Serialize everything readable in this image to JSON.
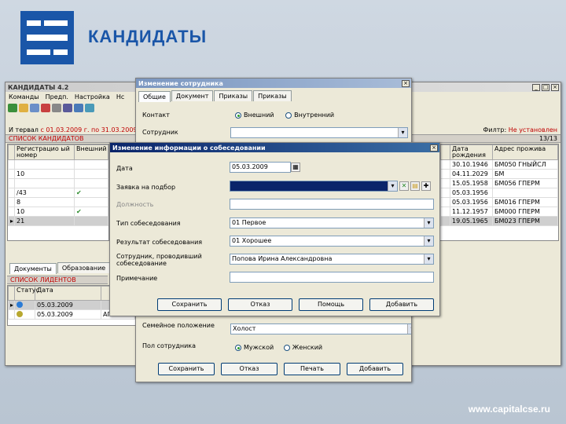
{
  "slide": {
    "title": "КАНДИДАТЫ",
    "footer": "www.capitalcse.ru"
  },
  "app": {
    "title": "КАНДИДАТЫ 4.2",
    "menu": [
      "Команды",
      "Предп.",
      "Настройка",
      "Нс"
    ],
    "filter_prefix": "И тервал",
    "filter_value": "с 01.03.2009 г. по 31.03.2009 г.",
    "filter_label": "Филтр:",
    "filter_state": "Не установлен",
    "list_header": "СПИСОК КАНДИДАТОВ",
    "list_count": "13/13",
    "columns": [
      "Регистрацио ый номер",
      "Внешний"
    ],
    "rows": [
      {
        "num": "",
        "check": ""
      },
      {
        "num": "10",
        "check": ""
      },
      {
        "num": "",
        "check": ""
      },
      {
        "num": "/43",
        "check": "✔"
      },
      {
        "num": "8",
        "check": ""
      },
      {
        "num": "10",
        "check": "✔"
      },
      {
        "num": "21",
        "check": ""
      }
    ],
    "right_columns": [
      "Дата рождения",
      "Адрес прожива"
    ],
    "right_rows": [
      [
        "30.10.1946",
        "БМ050 ГНЫЙСЛ"
      ],
      [
        "04.11.2029",
        "БМ"
      ],
      [
        "15.05.1958",
        "БМ056 ГПЕРМ"
      ],
      [
        "05.03.1956",
        ""
      ],
      [
        "05.03.1956",
        "БМ016 ГПЕРМ"
      ],
      [
        "11.12.1957",
        "БМ000 ГПЕРМ"
      ],
      [
        "19.05.1965",
        "БМ023 ГПЕРМ"
      ]
    ],
    "bottom_tabs": [
      "Документы",
      "Образование"
    ],
    "interviews_header": "СПИСОК ЛИДЕНТОВ",
    "interviews_columns": [
      "Статус",
      "Дата"
    ],
    "interviews_rows": [
      {
        "date": "05.03.2009",
        "extra": ""
      },
      {
        "date": "05.03.2009",
        "extra": "АГЕН"
      }
    ]
  },
  "employee": {
    "title": "Изменение сотрудника",
    "tabs": [
      "Общие",
      "Документ",
      "Приказы",
      "Приказы"
    ],
    "label_contact": "Контакт",
    "radio_external": "Внешний",
    "radio_internal": "Внутренний",
    "label_employee": "Сотрудник",
    "label_family": "Семейное положение",
    "family_value": "Холост",
    "label_sex": "Пол сотрудника",
    "radio_male": "Мужской",
    "radio_female": "Женский",
    "buttons": [
      "Сохранить",
      "Отказ",
      "Печать",
      "Добавить"
    ]
  },
  "interview": {
    "title": "Изменение информации о собеседовании",
    "label_date": "Дата",
    "date_value": "05.03.2009",
    "label_request": "Заявка на подбор",
    "request_value": "",
    "label_position": "Должность",
    "position_value": "",
    "label_type": "Тип собеседования",
    "type_value": "01 Первое",
    "label_result": "Результат собеседования",
    "result_value": "01 Хорошее",
    "label_staff": "Сотрудник, проводивший собеседование",
    "staff_value": "Попова Ирина Александровна",
    "label_note": "Примечание",
    "note_value": "",
    "buttons": [
      "Сохранить",
      "Отказ",
      "Помощь",
      "Добавить"
    ]
  }
}
